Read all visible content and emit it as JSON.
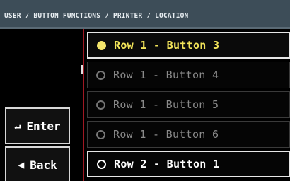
{
  "header": {
    "breadcrumb": "USER / BUTTON FUNCTIONS / PRINTER / LOCATION"
  },
  "side_buttons": {
    "enter": {
      "glyph": "↵",
      "label": "Enter"
    },
    "back": {
      "glyph": "◀",
      "label": "Back"
    }
  },
  "list": {
    "items": [
      {
        "label": "Row 1 - Button 3",
        "state": "selected"
      },
      {
        "label": "Row 1 - Button 4",
        "state": "normal"
      },
      {
        "label": "Row 1 - Button 5",
        "state": "normal"
      },
      {
        "label": "Row 1 - Button 6",
        "state": "normal"
      },
      {
        "label": "Row 2 - Button 1",
        "state": "current"
      }
    ]
  },
  "colors": {
    "header_bg": "#3d4d58",
    "selected_text": "#f2e45a",
    "divider": "#a01822"
  }
}
